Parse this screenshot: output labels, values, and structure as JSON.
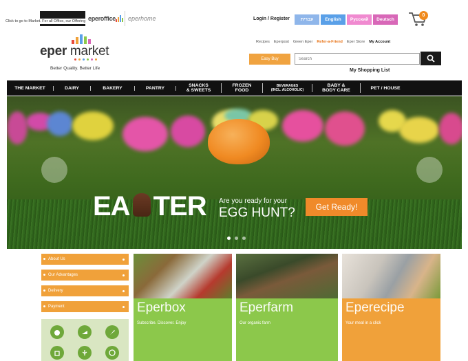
{
  "top": {
    "back_link": "Click to go to Market. For all Office, our Offering",
    "sites": [
      "eperoffice",
      "eperhome"
    ],
    "login": "Login / Register",
    "languages": [
      {
        "label": "עברית",
        "color": "#8fb6ea"
      },
      {
        "label": "English",
        "color": "#5aa0e8"
      },
      {
        "label": "Русский",
        "color": "#f08ad0"
      },
      {
        "label": "Deutsch",
        "color": "#d868b8"
      }
    ],
    "cart_count": "0"
  },
  "logo": {
    "name_bold": "eper",
    "name_rest": " market",
    "tagline": "Better Quality. Better Life"
  },
  "util_links": [
    "Recipes",
    "Eperpost",
    "Green Eper",
    "Refer-a-Friend",
    "Eper Store",
    "My Account"
  ],
  "search": {
    "easy_buy": "Easy Buy",
    "placeholder": "Search",
    "shopping_list": "My Shopping List"
  },
  "nav": [
    "THE MARKET",
    "DAIRY",
    "BAKERY",
    "PANTRY",
    "SNACKS\n& SWEETS",
    "FROZEN\nFOOD",
    "BEVERAGES\n(INCL. ALCOHOLIC)",
    "BABY &\nBODY CARE",
    "PET / HOUSE"
  ],
  "hero": {
    "title_left": "EA",
    "title_right": "TER",
    "q1": "Are you ready for your",
    "q2": "EGG HUNT?",
    "button": "Get Ready!"
  },
  "side_menu": [
    "About Us",
    "Our Advantages",
    "Delivery",
    "Payment"
  ],
  "cards": [
    {
      "title": "Eperbox",
      "sub": "Subscribe. Discover. Enjoy"
    },
    {
      "title": "Eperfarm",
      "sub": "Our organic farm"
    },
    {
      "title": "Eperecipe",
      "sub": "Your meal in a click"
    }
  ],
  "colors": {
    "orange": "#f0a13a",
    "green_card": "#8cc84b",
    "nav_bg": "#111111"
  }
}
